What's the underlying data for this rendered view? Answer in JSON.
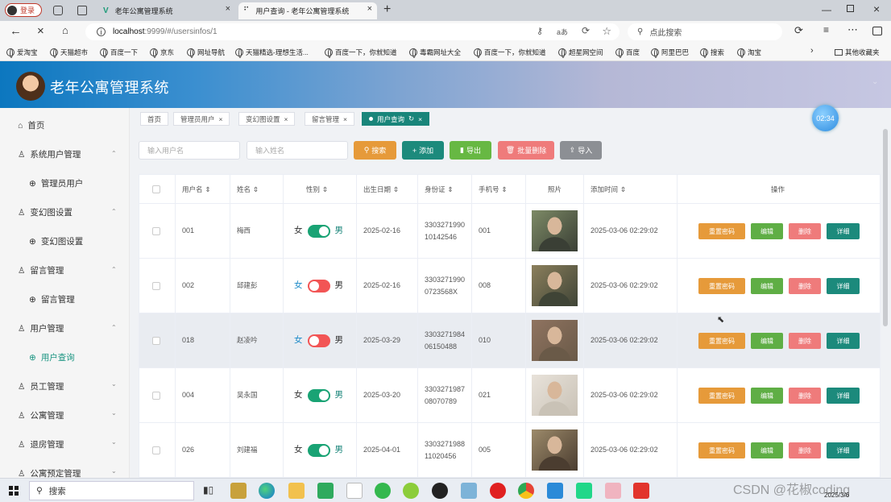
{
  "browser": {
    "login_label": "登录",
    "tabs": [
      {
        "title": "老年公寓管理系统"
      },
      {
        "title": "用户查询 - 老年公寓管理系统"
      }
    ],
    "url_host": "localhost",
    "url_rest": ":9999/#/usersinfos/1",
    "search_placeholder": "点此搜索",
    "bookmarks": [
      "爱淘宝",
      "天猫超市",
      "百度一下",
      "京东",
      "网址导航",
      "天猫精选-理想生活...",
      "百度一下，你就知道",
      "毒霸网址大全",
      "百度一下，你就知道",
      "超星网空间",
      "百度",
      "阿里巴巴",
      "搜索",
      "淘宝"
    ],
    "other_bookmarks": "其他收藏夹"
  },
  "app": {
    "title": "老年公寓管理系统",
    "timer": "02:34"
  },
  "sidebar": {
    "items": [
      {
        "label": "首页"
      },
      {
        "label": "系统用户管理"
      },
      {
        "label": "管理员用户"
      },
      {
        "label": "变幻图设置"
      },
      {
        "label": "变幻图设置"
      },
      {
        "label": "留言管理"
      },
      {
        "label": "留言管理"
      },
      {
        "label": "用户管理"
      },
      {
        "label": "用户查询"
      },
      {
        "label": "员工管理"
      },
      {
        "label": "公寓管理"
      },
      {
        "label": "退房管理"
      },
      {
        "label": "公寓预定管理"
      }
    ]
  },
  "breadcrumbs": [
    {
      "label": "首页"
    },
    {
      "label": "管理员用户"
    },
    {
      "label": "变幻图设置"
    },
    {
      "label": "留言管理"
    },
    {
      "label": "用户查询"
    }
  ],
  "toolbar": {
    "username_placeholder": "输入用户名",
    "name_placeholder": "输入姓名",
    "search": "搜索",
    "add": "添加",
    "export": "导出",
    "batch_delete": "批量删除",
    "import": "导入"
  },
  "table": {
    "headers": [
      "用户名",
      "姓名",
      "性别",
      "出生日期",
      "身份证",
      "手机号",
      "照片",
      "添加时间",
      "操作"
    ],
    "female": "女",
    "male": "男",
    "actions": {
      "reset": "重置密码",
      "edit": "编辑",
      "delete": "删除",
      "detail": "详细"
    },
    "rows": [
      {
        "username": "001",
        "name": "梅西",
        "male": true,
        "birth": "2025-02-16",
        "id1": "3303271990",
        "id2": "10142546",
        "phone": "001",
        "added": "2025-03-06 02:29:02"
      },
      {
        "username": "002",
        "name": "邱建彭",
        "male": false,
        "birth": "2025-02-16",
        "id1": "3303271990",
        "id2": "0723568X",
        "phone": "008",
        "added": "2025-03-06 02:29:02"
      },
      {
        "username": "018",
        "name": "赵凌吟",
        "male": false,
        "birth": "2025-03-29",
        "id1": "3303271984",
        "id2": "06150488",
        "phone": "010",
        "added": "2025-03-06 02:29:02"
      },
      {
        "username": "004",
        "name": "吴永国",
        "male": true,
        "birth": "2025-03-20",
        "id1": "3303271987",
        "id2": "08070789",
        "phone": "021",
        "added": "2025-03-06 02:29:02"
      },
      {
        "username": "026",
        "name": "刘建福",
        "male": true,
        "birth": "2025-04-01",
        "id1": "3303271988",
        "id2": "11020456",
        "phone": "005",
        "added": "2025-03-06 02:29:02"
      }
    ]
  },
  "taskbar": {
    "search": "搜索",
    "watermark": "CSDN @花椒coding",
    "date": "2025/3/6"
  },
  "colors": {
    "accent": "#19857a",
    "search": "#e69a3a",
    "add": "#1c8a7c",
    "export": "#67b843",
    "delete": "#ef7b7b",
    "import": "#8c8f94"
  }
}
